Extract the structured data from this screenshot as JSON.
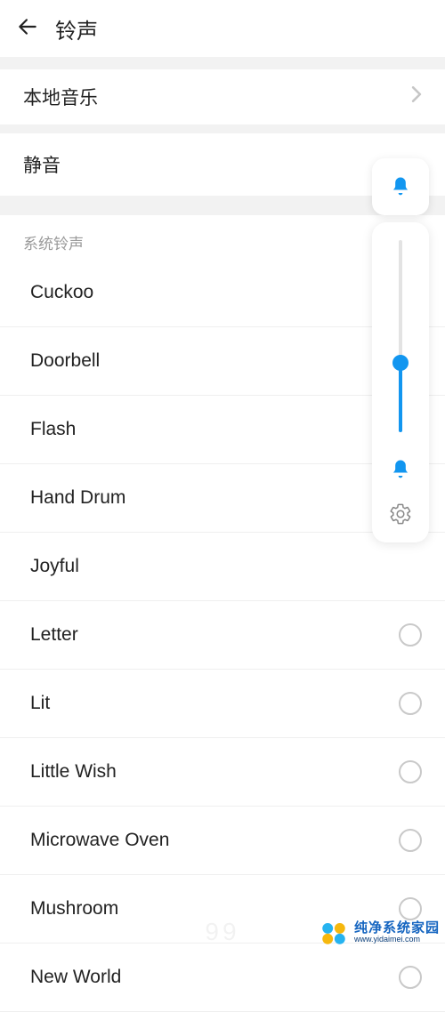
{
  "header": {
    "title": "铃声"
  },
  "local_music": {
    "label": "本地音乐"
  },
  "silent": {
    "label": "静音"
  },
  "system_tones": {
    "header": "系统铃声",
    "items": [
      {
        "name": "Cuckoo",
        "show_radio": false
      },
      {
        "name": "Doorbell",
        "show_radio": false
      },
      {
        "name": "Flash",
        "show_radio": false
      },
      {
        "name": "Hand Drum",
        "show_radio": false
      },
      {
        "name": "Joyful",
        "show_radio": false
      },
      {
        "name": "Letter",
        "show_radio": true
      },
      {
        "name": "Lit",
        "show_radio": true
      },
      {
        "name": "Little Wish",
        "show_radio": true
      },
      {
        "name": "Microwave Oven",
        "show_radio": true
      },
      {
        "name": "Mushroom",
        "show_radio": true
      },
      {
        "name": "New World",
        "show_radio": true
      }
    ]
  },
  "volume": {
    "percent": 36,
    "accent": "#1296f0"
  },
  "watermark": {
    "faint": "99",
    "brand": "纯净系统家园",
    "url": "www.yidaimei.com"
  }
}
